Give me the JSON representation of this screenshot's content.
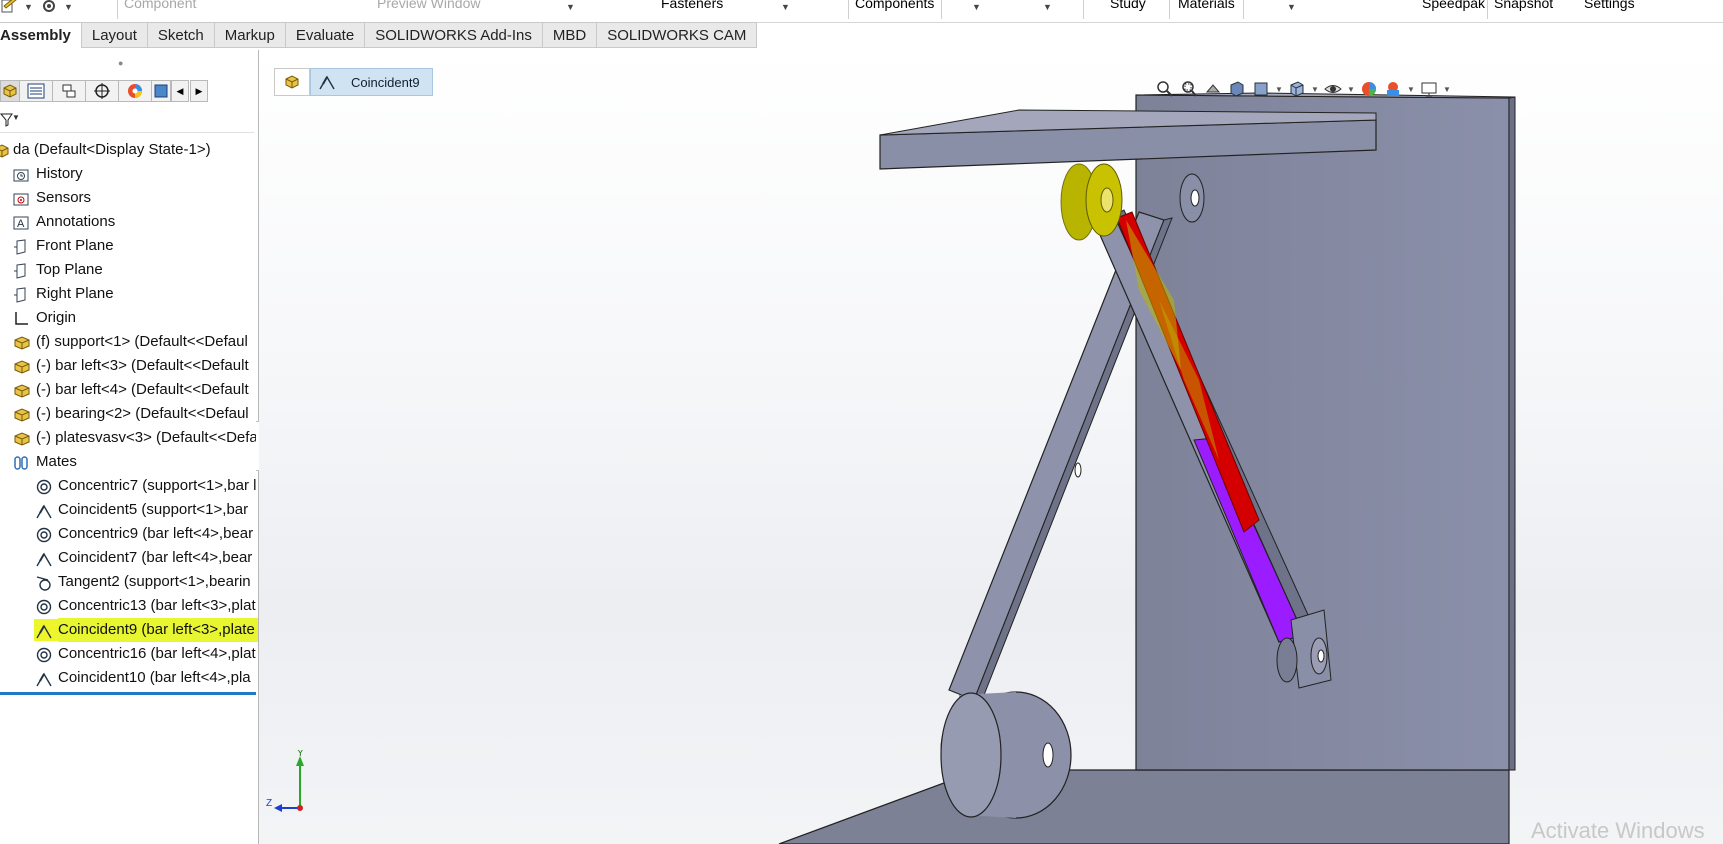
{
  "ribbon": {
    "items": [
      {
        "label": "Component",
        "dim": true
      },
      {
        "label": "Preview Window",
        "dim": true
      },
      {
        "label": "Fasteners",
        "dim": false
      },
      {
        "label": "Components",
        "dim": false
      },
      {
        "label": "Study",
        "dim": false
      },
      {
        "label": "Materials",
        "dim": false
      },
      {
        "label": "Speedpak",
        "dim": false
      },
      {
        "label": "Snapshot",
        "dim": false
      },
      {
        "label": "Settings",
        "dim": false
      }
    ]
  },
  "tabs": [
    "Assembly",
    "Layout",
    "Sketch",
    "Markup",
    "Evaluate",
    "SOLIDWORKS Add-Ins",
    "MBD",
    "SOLIDWORKS CAM"
  ],
  "active_tab": "Assembly",
  "tree": {
    "root": "da  (Default<Display State-1>)",
    "folders": [
      {
        "label": "History",
        "icon": "history-folder-icon"
      },
      {
        "label": "Sensors",
        "icon": "sensors-icon"
      },
      {
        "label": "Annotations",
        "icon": "annotations-icon"
      },
      {
        "label": "Front Plane",
        "icon": "plane-icon"
      },
      {
        "label": "Top Plane",
        "icon": "plane-icon"
      },
      {
        "label": "Right Plane",
        "icon": "plane-icon"
      },
      {
        "label": "Origin",
        "icon": "origin-icon"
      }
    ],
    "components": [
      "(f) support<1> (Default<<Defaul",
      "(-) bar left<3> (Default<<Default",
      "(-) bar left<4> (Default<<Default",
      "(-) bearing<2> (Default<<Defaul",
      "(-) platesvasv<3> (Default<<Defa"
    ],
    "mates_label": "Mates",
    "mates": [
      {
        "label": "Concentric7 (support<1>,bar l",
        "type": "concentric"
      },
      {
        "label": "Coincident5 (support<1>,bar",
        "type": "coincident"
      },
      {
        "label": "Concentric9 (bar left<4>,bear",
        "type": "concentric"
      },
      {
        "label": "Coincident7 (bar left<4>,bear",
        "type": "coincident"
      },
      {
        "label": "Tangent2 (support<1>,bearin",
        "type": "tangent"
      },
      {
        "label": "Concentric13 (bar left<3>,plat",
        "type": "concentric"
      },
      {
        "label": "Coincident9 (bar left<3>,plate",
        "type": "coincident",
        "selected": true
      },
      {
        "label": "Concentric16 (bar left<4>,plat",
        "type": "concentric"
      },
      {
        "label": "Coincident10 (bar left<4>,pla",
        "type": "coincident"
      }
    ]
  },
  "breadcrumb": {
    "selected": "Coincident9"
  },
  "triad": {
    "y": "Y",
    "z": "Z"
  },
  "watermark": "Activate Windows",
  "colors": {
    "selection_highlight": "#eef52a",
    "model_gray": "#8a8fa8",
    "red_face": "#d40000",
    "purple_face": "#9b1cff",
    "breadcrumb_blue": "#cfe3f3"
  }
}
